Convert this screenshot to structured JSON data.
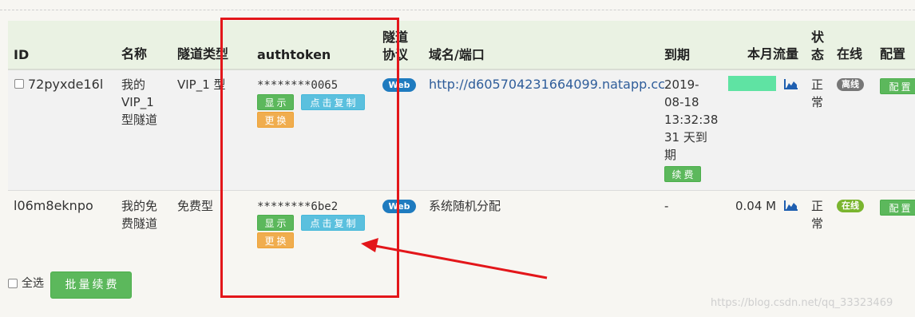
{
  "headers": {
    "id": "ID",
    "name": "名称",
    "tunnel_type": "隧道类型",
    "authtoken": "authtoken",
    "protocol_1": "隧道",
    "protocol_2": "协议",
    "domain_port": "域名/端口",
    "expiry": "到期",
    "monthly_traffic": "本月流量",
    "status_1": "状",
    "status_2": "态",
    "online": "在线",
    "config": "配置"
  },
  "rows": [
    {
      "id": "72pyxde16l",
      "name_lines": [
        "我的",
        "VIP_1",
        "型隧道"
      ],
      "type": "VIP_1 型",
      "authtoken": "********0065",
      "btn_show": "显示",
      "btn_copy": "点击复制",
      "btn_change": "更换",
      "protocol_badge": "Web",
      "domain": "http://d605704231664099.natapp.cc",
      "expiry_lines": [
        "2019-",
        "08-18",
        "13:32:38",
        "31 天到",
        "期"
      ],
      "renew_btn": "续费",
      "traffic": "",
      "status_lines": [
        "正",
        "常"
      ],
      "online": "离线",
      "config_btn": "配置"
    },
    {
      "id": "l06m8eknpo",
      "name_lines": [
        "我的免",
        "费隧道"
      ],
      "type": "免费型",
      "authtoken": "********6be2",
      "btn_show": "显示",
      "btn_copy": "点击复制",
      "btn_change": "更换",
      "protocol_badge": "Web",
      "domain": "系统随机分配",
      "expiry_lines": [
        "-"
      ],
      "traffic": "0.04 M",
      "status_lines": [
        "正",
        "常"
      ],
      "online": "在线",
      "config_btn": "配置"
    }
  ],
  "footer": {
    "select_all": "全选",
    "batch_renew": "批量续费"
  },
  "watermark": "https://blog.csdn.net/qq_33323469",
  "colors": {
    "header_bg": "#eaf2e3",
    "highlight": "#e3161a",
    "traffic_bar": "#5fe3a3"
  }
}
